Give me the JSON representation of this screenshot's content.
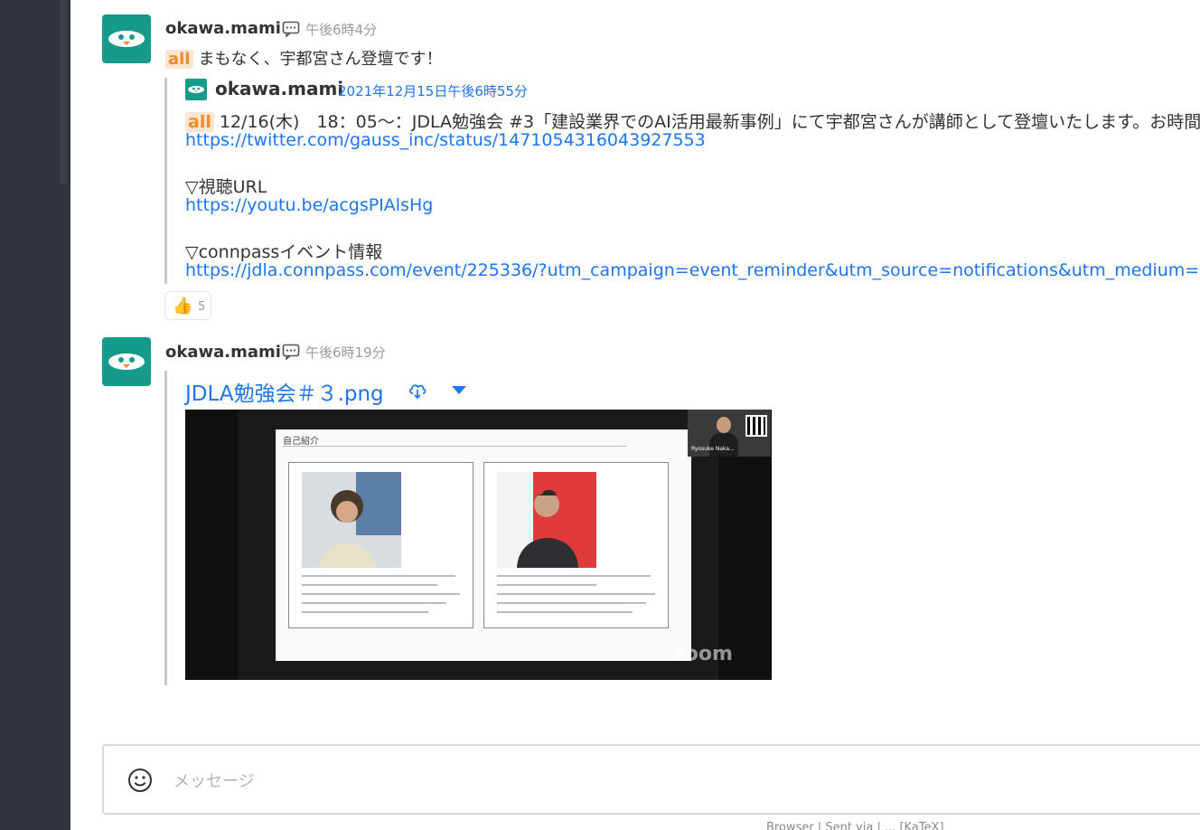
{
  "messages": [
    {
      "username": "okawa.mami",
      "time": "午後6時4分",
      "badge": "all",
      "text": "まもなく、宇都宮さん登壇です！",
      "quote": {
        "username": "okawa.mami",
        "time": "2021年12月15日午後6時55分",
        "badge": "all",
        "line1": "12/16(木)　18：05〜：JDLA勉強会 #3「建設業界でのAI活用最新事例」にて宇都宮さんが講師として登壇いたします。お時間OK",
        "link1": "https://twitter.com/gauss_inc/status/1471054316043927553",
        "label2": "▽視聴URL",
        "link2": "https://youtu.be/acgsPIAlsHg",
        "label3": "▽connpassイベント情報",
        "link3": "https://jdla.connpass.com/event/225336/?utm_campaign=event_reminder&utm_source=notifications&utm_medium=ema"
      },
      "reaction": {
        "emoji": "👍",
        "count": "5"
      }
    },
    {
      "username": "okawa.mami",
      "time": "午後6時19分",
      "file": {
        "name": "JDLA勉強会＃３.png",
        "slide": {
          "heading": "自己紹介",
          "cam_label": "Ryosuke Naka...",
          "watermark": "zoom"
        }
      }
    }
  ],
  "composer": {
    "placeholder": "メッセージ"
  },
  "footer": {
    "hint": "Browser | Sent via | ... [KaTeX]"
  },
  "icons": {
    "thread": "thread-icon",
    "download": "cloud-download-icon",
    "emoji": "smiley-icon"
  },
  "colors": {
    "sidebar": "#2f343d",
    "link": "#1d74f5",
    "avatar": "#159a8c",
    "badge_bg": "#fde4d0",
    "badge_fg": "#f38c2b"
  }
}
